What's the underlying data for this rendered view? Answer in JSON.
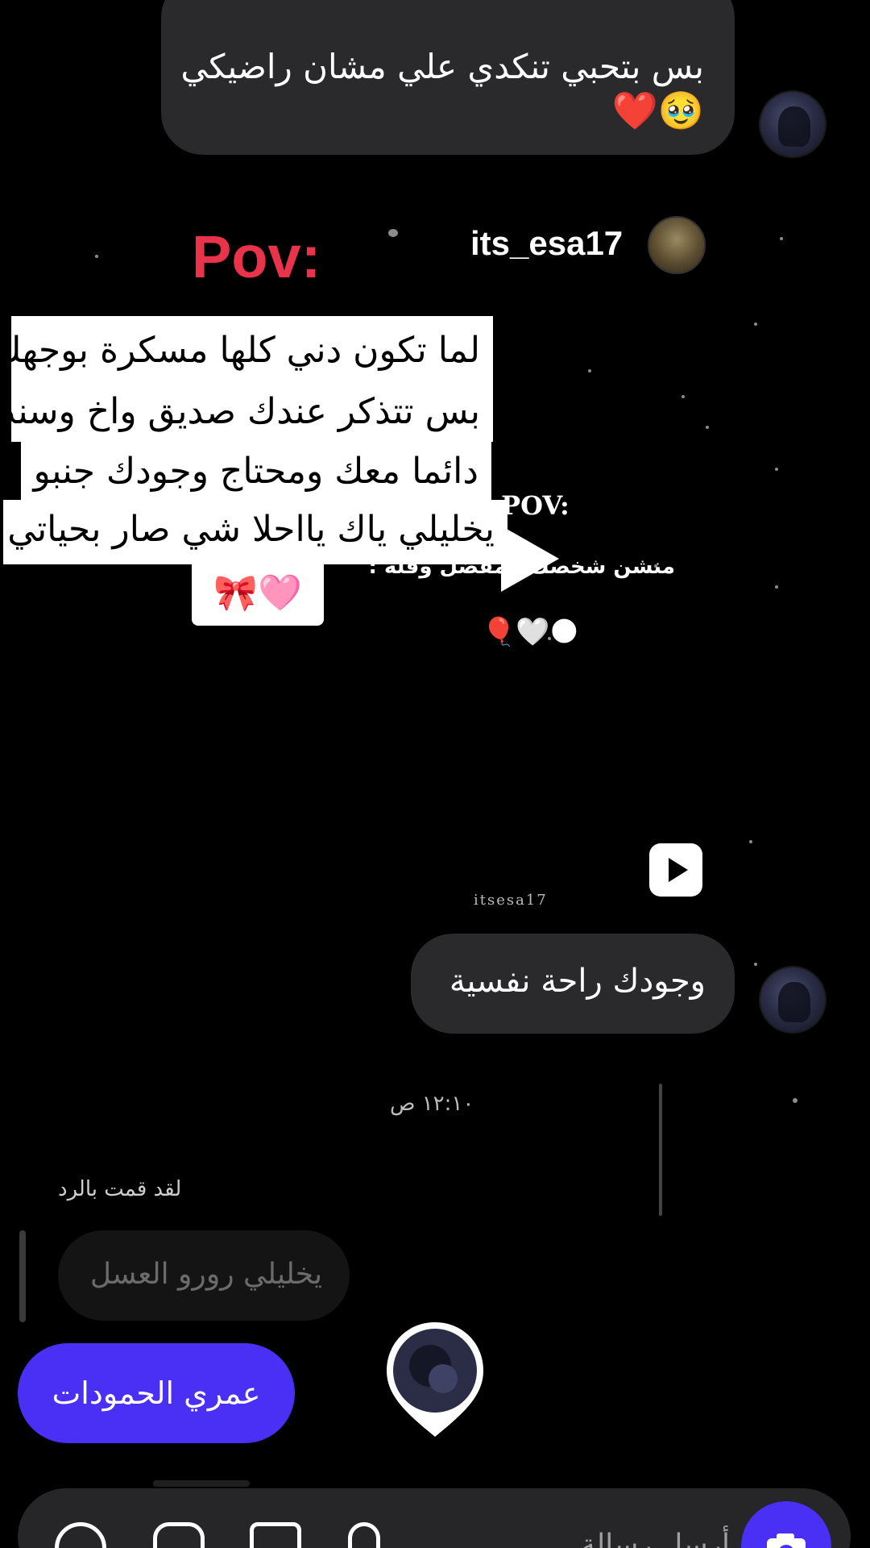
{
  "messages": {
    "top_partial_line": "بس بتحبي تنكدي علي مشان راضيكي",
    "top_emoji": "🥹❤️",
    "sent_reply": "وجودك راحة نفسية"
  },
  "shared_post": {
    "username": "its_esa17",
    "pov_label": "Pov:",
    "sticker_lines": [
      "لما تكون دني كلها مسكرة بوجهك",
      "بس تتذكر عندك صديق واخ وسند",
      "دائما معك ومحتاج وجودك جنبو",
      "يخليلي ياك يااحلا شي صار بحياتي",
      "🩷🎀"
    ],
    "inner_pov": "POV:",
    "inner_caption": "منشن شخصك المفضل وقله :",
    "inner_emoji": "🎈🤍🌑",
    "watermark": "itsesa17"
  },
  "timestamp": "١٢:١٠ ص",
  "reply_context": {
    "label": "لقد قمت بالرد",
    "quoted": "يخليلي رورو العسل"
  },
  "reaction_button": {
    "label": "عمري الحمودات"
  },
  "composer": {
    "placeholder": "أرسل رسالة..."
  },
  "colors": {
    "accent": "#4a2ff5",
    "pov_red": "#e8334a",
    "bubble": "#2a2a2c"
  }
}
